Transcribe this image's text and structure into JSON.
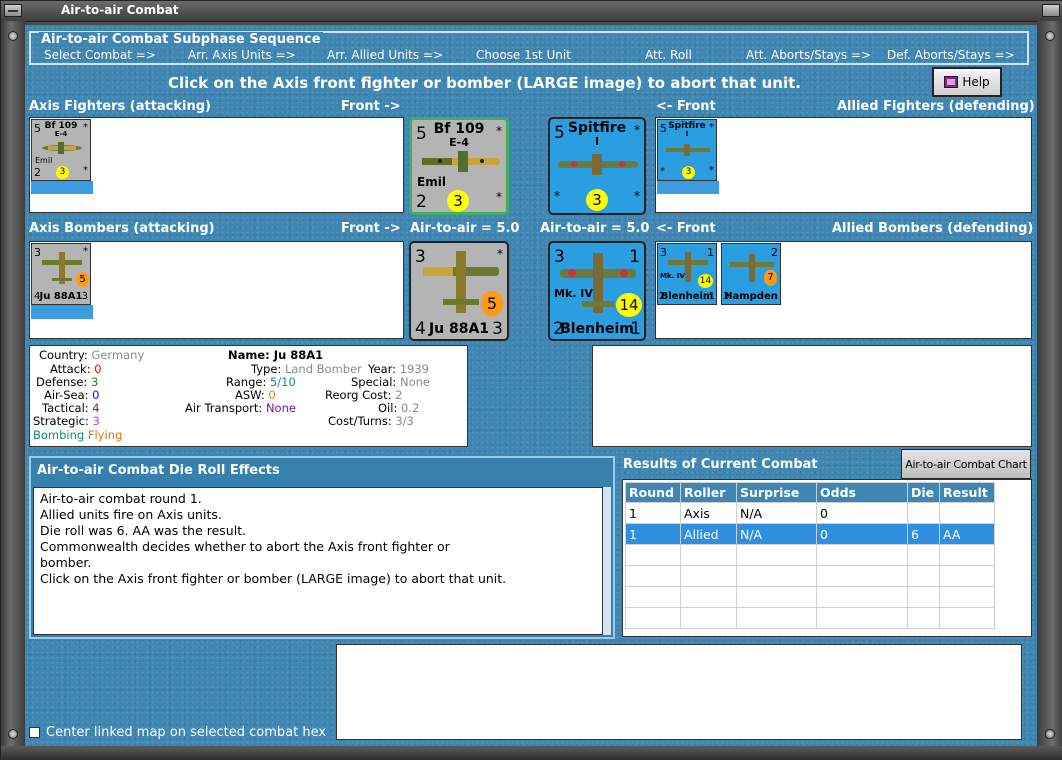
{
  "window": {
    "title": "Air-to-air Combat"
  },
  "sequence": {
    "title": "Air-to-air Combat Subphase Sequence",
    "steps": [
      "Select Combat =>",
      "Arr. Axis Units =>",
      "Arr. Allied Units =>",
      "Choose 1st Unit",
      "Att. Roll",
      "Att. Aborts/Stays =>",
      "Def. Aborts/Stays =>"
    ]
  },
  "instruction": "Click on the Axis front fighter or bomber  (LARGE image) to abort that unit.",
  "help_label": "Help",
  "sections": {
    "axis_fighters": "Axis Fighters (attacking)",
    "front_right": "Front ->",
    "front_left": "<- Front",
    "allied_fighters": "Allied Fighters (defending)",
    "axis_bombers": "Axis Bombers (attacking)",
    "allied_bombers": "Allied Bombers (defending)",
    "air_to_air_axis": "Air-to-air = 5.0",
    "air_to_air_allied": "Air-to-air = 5.0"
  },
  "units": {
    "bf109": {
      "attack": "5",
      "defense": "2",
      "name": "Bf 109",
      "sub": "E-4",
      "nick": "Emil",
      "badge": "3",
      "star": "*"
    },
    "spitfire": {
      "attack": "5",
      "name": "Spitfire",
      "sub": "I",
      "badge": "3",
      "star": "*"
    },
    "ju88": {
      "top_left": "3",
      "bottom_left": "4",
      "name": "Ju 88A1",
      "bottom_right": "3",
      "badge": "5",
      "star": "*"
    },
    "blenheim": {
      "top_left": "3",
      "top_right": "1",
      "sub": "Mk. IV",
      "bottom_left": "2",
      "name": "Blenheim",
      "bottom_right": "1",
      "badge": "14"
    },
    "hampden": {
      "top_right": "2",
      "bottom_left": "3",
      "name": "Hampden",
      "badge": "7"
    }
  },
  "info": {
    "country_label": "Country:",
    "country": "Germany",
    "attack_label": "Attack:",
    "attack": "0",
    "defense_label": "Defense:",
    "defense": "3",
    "airsea_label": "Air-Sea:",
    "airsea": "0",
    "tactical_label": "Tactical:",
    "tactical": "4",
    "strategic_label": "Strategic:",
    "strategic": "3",
    "bombing": "Bombing",
    "flying": "Flying",
    "name_label": "Name:",
    "name": "Ju 88A1",
    "type_label": "Type:",
    "type": "Land Bomber",
    "range_label": "Range:",
    "range": "5/10",
    "asw_label": "ASW:",
    "asw": "0",
    "transport_label": "Air Transport:",
    "transport": "None",
    "year_label": "Year:",
    "year": "1939",
    "special_label": "Special:",
    "special": "None",
    "reorg_label": "Reorg Cost:",
    "reorg": "2",
    "oil_label": "Oil:",
    "oil": "0.2",
    "cost_label": "Cost/Turns:",
    "cost": "3/3"
  },
  "die_effects": {
    "title": "Air-to-air Combat Die Roll Effects",
    "lines": [
      "Air-to-air combat round 1.",
      "Allied units fire on Axis units.",
      "Die roll was 6.  AA was the result.",
      "Commonwealth decides whether to abort the Axis front fighter or",
      "bomber.",
      "Click on the Axis front fighter or bomber  (LARGE image) to abort that unit."
    ]
  },
  "results": {
    "title": "Results of Current Combat",
    "chart_button": "Air-to-air Combat Chart",
    "columns": [
      "Round",
      "Roller",
      "Surprise",
      "Odds",
      "Die",
      "Result"
    ],
    "rows": [
      [
        "1",
        "Axis",
        "N/A",
        "0",
        "",
        ""
      ],
      [
        "1",
        "Allied",
        "N/A",
        "0",
        "6",
        "AA"
      ]
    ],
    "selected_row": 1
  },
  "center_map_label": "Center linked map on selected combat hex",
  "colors": {
    "panel_blue": "#3f86b3",
    "fighter_axis_bg": "#b4b4b4",
    "fighter_allied_bg": "#2a9ee0",
    "select_blue": "#2f8fe0",
    "badge_yellow": "#ffff00",
    "badge_orange": "#ff9a1a"
  }
}
